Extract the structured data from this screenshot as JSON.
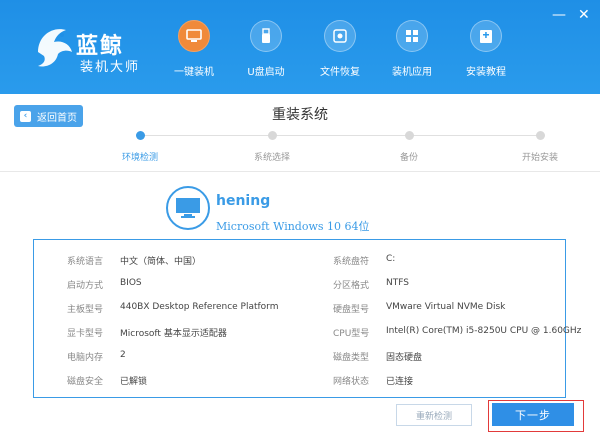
{
  "app": {
    "brand_main": "蓝鲸",
    "brand_sub": "装机大师"
  },
  "nav": {
    "items": [
      {
        "label": "一键装机",
        "icon": "monitor-icon",
        "active": true
      },
      {
        "label": "U盘启动",
        "icon": "usb-icon",
        "active": false
      },
      {
        "label": "文件恢复",
        "icon": "file-recover-icon",
        "active": false
      },
      {
        "label": "装机应用",
        "icon": "apps-grid-icon",
        "active": false
      },
      {
        "label": "安装教程",
        "icon": "tutorial-icon",
        "active": false
      }
    ]
  },
  "window": {
    "minimize": "—",
    "close": "✕"
  },
  "subheader": {
    "back_label": "返回首页",
    "title": "重装系统"
  },
  "steps": [
    {
      "label": "环境检测",
      "active": true
    },
    {
      "label": "系统选择",
      "active": false
    },
    {
      "label": "备份",
      "active": false
    },
    {
      "label": "开始安装",
      "active": false
    }
  ],
  "computer": {
    "name": "hening",
    "os": "Microsoft Windows 10 64位"
  },
  "info": [
    {
      "label": "系统语言",
      "value": "中文（简体、中国）"
    },
    {
      "label": "系统盘符",
      "value": "C:"
    },
    {
      "label": "启动方式",
      "value": "BIOS"
    },
    {
      "label": "分区格式",
      "value": "NTFS"
    },
    {
      "label": "主板型号",
      "value": "440BX Desktop Reference Platform"
    },
    {
      "label": "硬盘型号",
      "value": "VMware Virtual NVMe Disk"
    },
    {
      "label": "显卡型号",
      "value": "Microsoft 基本显示适配器"
    },
    {
      "label": "CPU型号",
      "value": "Intel(R) Core(TM) i5-8250U CPU @ 1.60GHz"
    },
    {
      "label": "电脑内存",
      "value": "2"
    },
    {
      "label": "磁盘类型",
      "value": "固态硬盘"
    },
    {
      "label": "磁盘安全",
      "value": "已解锁"
    },
    {
      "label": "网络状态",
      "value": "已连接"
    }
  ],
  "buttons": {
    "recheck": "重新检测",
    "next": "下一步"
  },
  "colors": {
    "header_blue": "#2a9bec",
    "accent_blue": "#3a9be6",
    "active_nav_orange": "#f08a3a",
    "next_outline_red": "#e23a3a"
  }
}
